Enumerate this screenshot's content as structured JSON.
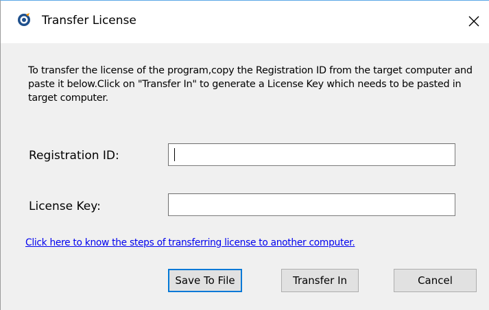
{
  "window": {
    "title": "Transfer License",
    "close_symbol": "✕",
    "app_icon": "app-logo-icon"
  },
  "description": "To transfer the license of the program,copy the Registration ID from the target computer and paste it below.Click on \"Transfer In\" to generate a License Key which needs to be pasted in target computer.",
  "form": {
    "registration_label": "Registration ID:",
    "registration_value": "",
    "license_label": "License Key:",
    "license_value": ""
  },
  "help_link": "Click here to know the steps of transferring license to another computer.",
  "buttons": {
    "save": "Save To File",
    "transfer": "Transfer In",
    "cancel": "Cancel"
  },
  "colors": {
    "link": "#0000ee",
    "focus_border": "#0078d7",
    "dialog_bg": "#f0f0f0"
  }
}
